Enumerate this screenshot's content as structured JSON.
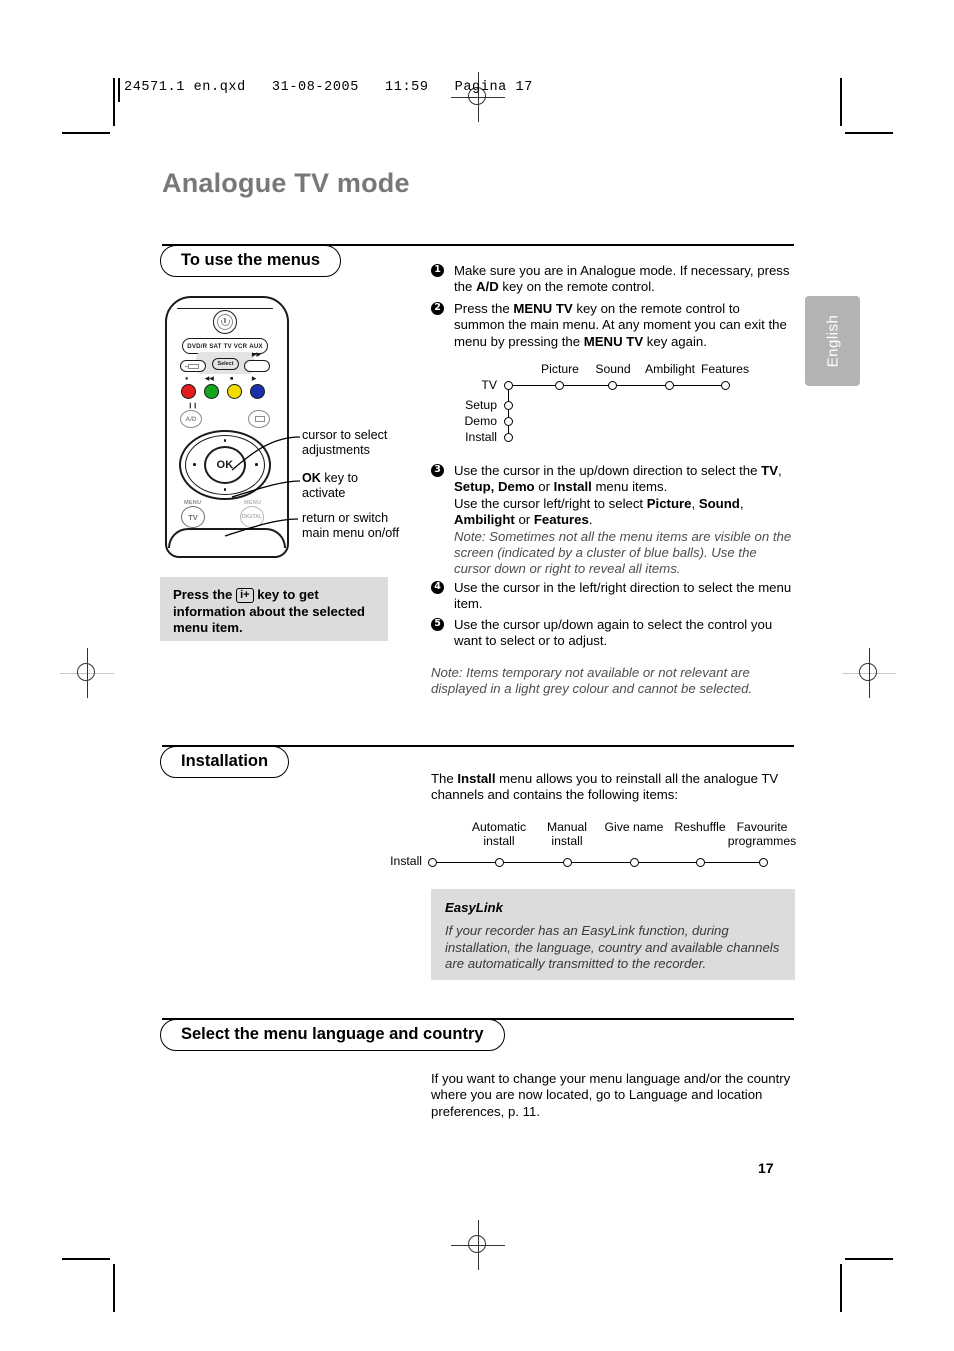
{
  "print_header": {
    "text": "24571.1 en.qxd   31-08-2005   11:59   Pagina 17"
  },
  "language_tab": {
    "label": "English"
  },
  "page_title": "Analogue TV mode",
  "page_number": "17",
  "sections": {
    "menus": {
      "heading": "To use the menus",
      "steps": [
        {
          "num": "1",
          "html": "Make sure you are in Analogue mode. If necessary, press the <b>A/D</b> key on the remote control."
        },
        {
          "num": "2",
          "html": "Press the <b>MENU TV</b> key on the remote control to summon the main menu. At any moment you can exit the menu by pressing the <b>MENU TV</b> key again."
        },
        {
          "num": "3",
          "html": "Use the cursor in the up/down direction to select the <b>TV</b>, <b>Setup, Demo</b> or <b>Install</b> menu items.<br><b>Use the cursor left/right to select <span style=\"font-weight:normal\">Picture</span>, <span style=\"font-weight:normal\">Sound</span>, Ambilight or Features.</b>"
        },
        {
          "num": "4",
          "html": "Use the cursor in the left/right direction to select the menu item."
        },
        {
          "num": "5",
          "html": "Use the cursor up/down again to select the control you want to select or to adjust."
        }
      ],
      "step3_bold_lines": "Use the cursor left/right to select Picture, Sound, Ambilight or Features.",
      "step3_note": "Note: Sometimes not all the menu items are visible on the screen  (indicated by a cluster of blue balls). Use the cursor down or right to reveal all items.",
      "final_note": "Note: Items temporary not available or not relevant are displayed in a light grey colour and cannot be selected.",
      "info_box": {
        "before": "Press the",
        "key": "i+",
        "after": "key to get information about the selected menu item."
      }
    },
    "installation": {
      "heading": "Installation",
      "intro_html": "The <b>Install</b> menu allows you to reinstall all the analogue TV channels and contains the following items:",
      "easylink": {
        "title": "EasyLink",
        "body": "If your recorder has an EasyLink function, during installation, the language, country and available channels are automatically transmitted to the recorder."
      }
    },
    "language_country": {
      "heading": "Select the menu language and country",
      "body": "If you want to change your menu language and/or the country where you are now located, go to Language and location preferences, p. 11."
    }
  },
  "menu_tree": {
    "root": "TV",
    "vertical_items": [
      "TV",
      "Setup",
      "Demo",
      "Install"
    ],
    "horizontal_items": [
      "Picture",
      "Sound",
      "Ambilight",
      "Features"
    ]
  },
  "install_tree": {
    "root": "Install",
    "items": [
      {
        "line1": "Automatic",
        "line2": "install"
      },
      {
        "line1": "Manual",
        "line2": "install"
      },
      {
        "line1": "Give name",
        "line2": ""
      },
      {
        "line1": "Reshuffle",
        "line2": ""
      },
      {
        "line1": "Favourite",
        "line2": "programmes"
      }
    ]
  },
  "remote": {
    "power_icon": "power-icon",
    "source_buttons": [
      "DVD/R",
      "SAT",
      "TV",
      "VCR",
      "AUX"
    ],
    "select_label": "Select",
    "colour_buttons": [
      "#e21d1d",
      "#16a61d",
      "#f2dc00",
      "#1b2fa8"
    ],
    "ad_label": "A/D",
    "ok_label": "OK",
    "menu_tv_small": "MENU",
    "menu_tv_label": "TV",
    "menu_digital_small": "MENU",
    "menu_digital_label": "DIGITAL",
    "callouts": [
      "cursor to select adjustments",
      "OK key to activate",
      "return or switch main menu on/off"
    ],
    "callout_ok_bold": "OK",
    "callout_ok_rest": " key to",
    "callout_ok_line2": "activate",
    "callout1_line1": "cursor to select",
    "callout1_line2": "adjustments",
    "callout3_line1": "return or switch",
    "callout3_line2": "main menu on/off"
  }
}
